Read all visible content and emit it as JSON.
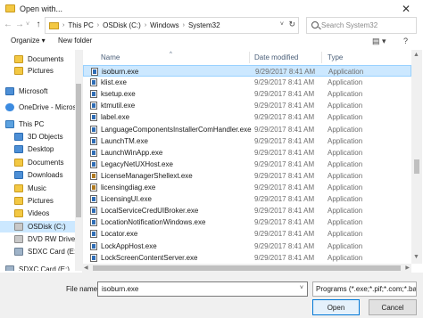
{
  "window": {
    "title": "Open with...",
    "close_glyph": "✕"
  },
  "nav": {
    "back": "←",
    "forward": "→",
    "recent": "˅",
    "up": "↑"
  },
  "address": {
    "segments": [
      "This PC",
      "OSDisk (C:)",
      "Windows",
      "System32"
    ],
    "sep": "›",
    "first_sep": "›",
    "dropdown": "˅",
    "refresh": "↻"
  },
  "search": {
    "placeholder": "Search System32"
  },
  "toolbar": {
    "organize": "Organize ▾",
    "new_folder": "New folder",
    "view": "▤ ▾",
    "help": "?"
  },
  "nav_pane": {
    "items": [
      {
        "label": "Documents",
        "icon": "documents-icon",
        "kind": "fold"
      },
      {
        "label": "Pictures",
        "icon": "pictures-icon",
        "kind": "fold"
      },
      {
        "label": "Microsoft",
        "icon": "microsoft-icon",
        "kind": "blue"
      },
      {
        "label": "OneDrive - Micros",
        "icon": "onedrive-icon",
        "kind": "cloud"
      },
      {
        "label": "This PC",
        "icon": "this-pc-icon",
        "kind": "pc"
      },
      {
        "label": "3D Objects",
        "icon": "3d-objects-icon",
        "kind": "blue"
      },
      {
        "label": "Desktop",
        "icon": "desktop-icon",
        "kind": "blue"
      },
      {
        "label": "Documents",
        "icon": "documents-icon",
        "kind": "fold"
      },
      {
        "label": "Downloads",
        "icon": "downloads-icon",
        "kind": "blue"
      },
      {
        "label": "Music",
        "icon": "music-icon",
        "kind": "fold"
      },
      {
        "label": "Pictures",
        "icon": "pictures-icon",
        "kind": "fold"
      },
      {
        "label": "Videos",
        "icon": "videos-icon",
        "kind": "fold"
      },
      {
        "label": "OSDisk (C:)",
        "icon": "drive-icon",
        "kind": "drive"
      },
      {
        "label": "DVD RW Drive (",
        "icon": "dvd-drive-icon",
        "kind": "drive"
      },
      {
        "label": "SDXC Card (E:)",
        "icon": "sd-card-icon",
        "kind": "card"
      },
      {
        "label": "SDXC Card (E:)",
        "icon": "sd-card-icon",
        "kind": "card"
      }
    ]
  },
  "columns": {
    "name": "Name",
    "date": "Date modified",
    "type": "Type",
    "sort": "^"
  },
  "files": [
    {
      "name": "isoburn.exe",
      "date": "9/29/2017 8:41 AM",
      "type": "Application"
    },
    {
      "name": "klist.exe",
      "date": "9/29/2017 8:41 AM",
      "type": "Application"
    },
    {
      "name": "ksetup.exe",
      "date": "9/29/2017 8:41 AM",
      "type": "Application"
    },
    {
      "name": "ktmutil.exe",
      "date": "9/29/2017 8:41 AM",
      "type": "Application"
    },
    {
      "name": "label.exe",
      "date": "9/29/2017 8:41 AM",
      "type": "Application"
    },
    {
      "name": "LanguageComponentsInstallerComHandler.exe",
      "date": "9/29/2017 8:41 AM",
      "type": "Application"
    },
    {
      "name": "LaunchTM.exe",
      "date": "9/29/2017 8:41 AM",
      "type": "Application"
    },
    {
      "name": "LaunchWinApp.exe",
      "date": "9/29/2017 8:41 AM",
      "type": "Application"
    },
    {
      "name": "LegacyNetUXHost.exe",
      "date": "9/29/2017 8:41 AM",
      "type": "Application"
    },
    {
      "name": "LicenseManagerShellext.exe",
      "date": "9/29/2017 8:41 AM",
      "type": "Application"
    },
    {
      "name": "licensingdiag.exe",
      "date": "9/29/2017 8:41 AM",
      "type": "Application"
    },
    {
      "name": "LicensingUI.exe",
      "date": "9/29/2017 8:41 AM",
      "type": "Application"
    },
    {
      "name": "LocalServiceCredUIBroker.exe",
      "date": "9/29/2017 8:41 AM",
      "type": "Application"
    },
    {
      "name": "LocationNotificationWindows.exe",
      "date": "9/29/2017 8:41 AM",
      "type": "Application"
    },
    {
      "name": "Locator.exe",
      "date": "9/29/2017 8:41 AM",
      "type": "Application"
    },
    {
      "name": "LockAppHost.exe",
      "date": "9/29/2017 8:41 AM",
      "type": "Application"
    },
    {
      "name": "LockScreenContentServer.exe",
      "date": "9/29/2017 8:41 AM",
      "type": "Application"
    }
  ],
  "bottom": {
    "file_name_label": "File name:",
    "file_name_value": "isoburn.exe",
    "file_name_drop": "˅",
    "file_type": "Programs (*.exe;*.pif;*.com;*.ba",
    "open": "Open",
    "cancel": "Cancel"
  }
}
